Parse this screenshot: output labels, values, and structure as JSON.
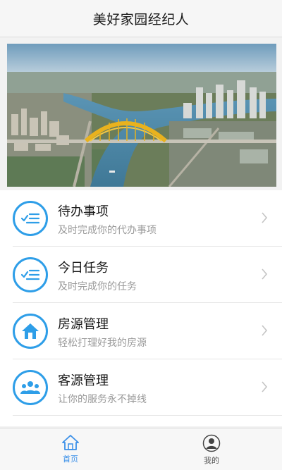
{
  "header": {
    "title": "美好家园经纪人"
  },
  "banner": {
    "image": "aerial-city-river-bridge"
  },
  "menu": [
    {
      "title": "待办事项",
      "subtitle": "及时完成你的代办事项",
      "icon": "checklist-icon"
    },
    {
      "title": "今日任务",
      "subtitle": "及时完成你的任务",
      "icon": "checklist-icon"
    },
    {
      "title": "房源管理",
      "subtitle": "轻松打理好我的房源",
      "icon": "house-icon"
    },
    {
      "title": "客源管理",
      "subtitle": "让你的服务永不掉线",
      "icon": "people-icon"
    }
  ],
  "tabbar": {
    "home_label": "首页",
    "mine_label": "我的"
  },
  "colors": {
    "accent": "#2e9ee8",
    "tab_active": "#3a8fe8"
  }
}
